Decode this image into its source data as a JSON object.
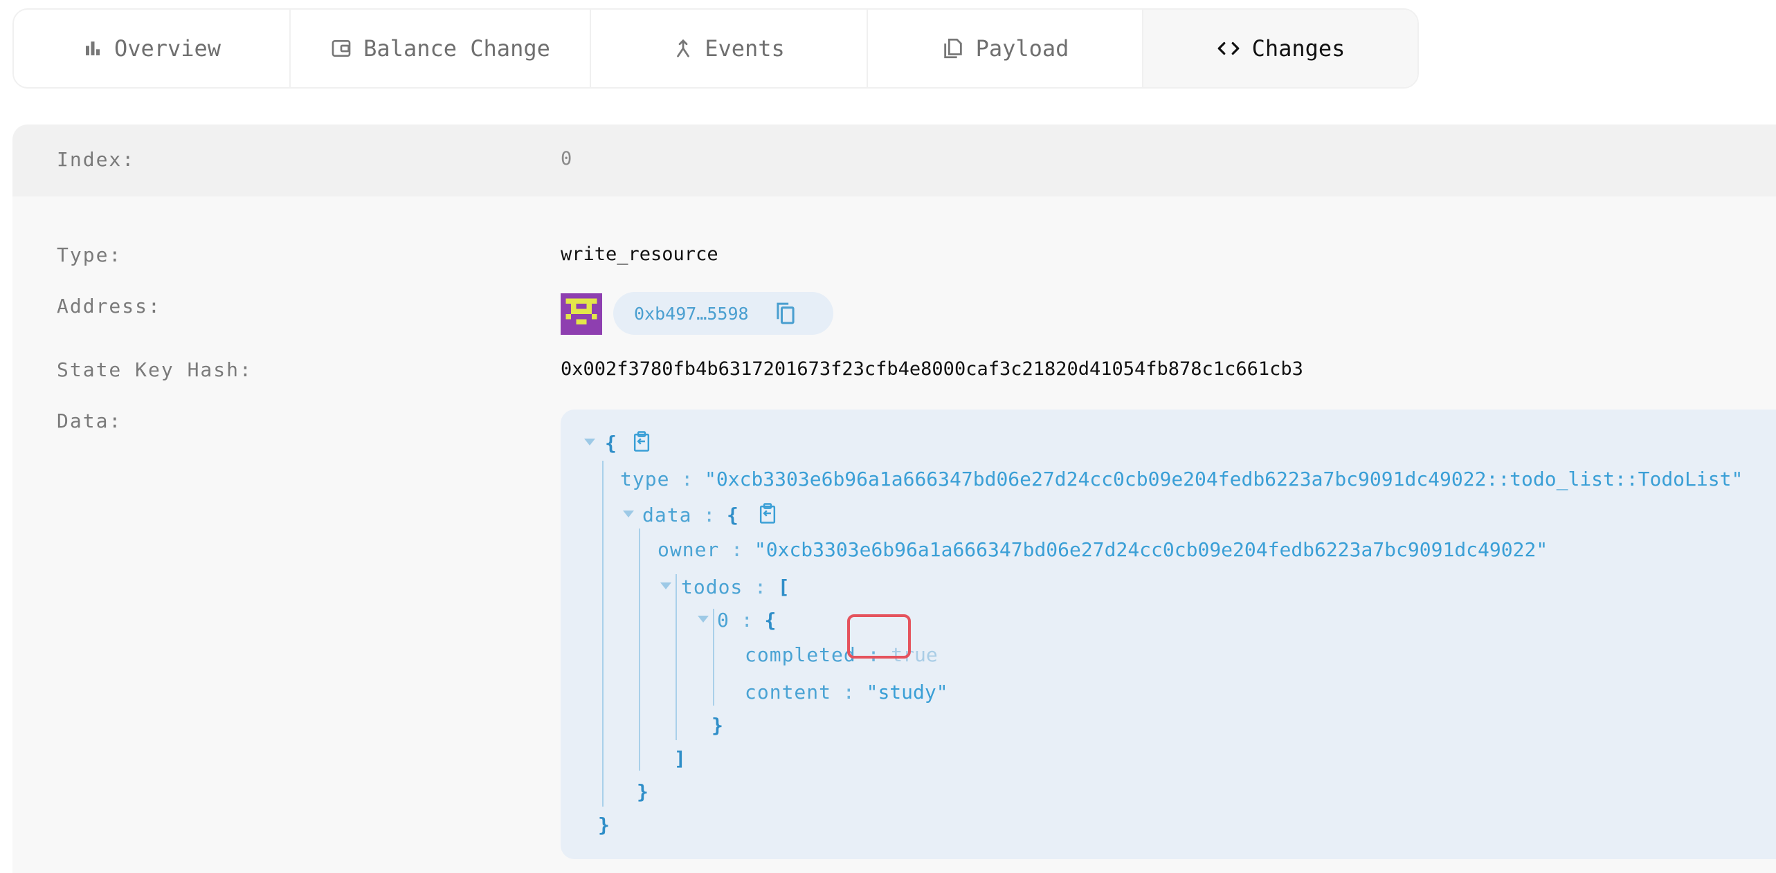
{
  "tabs": [
    {
      "label": "Overview",
      "icon": "bar-chart-icon"
    },
    {
      "label": "Balance Change",
      "icon": "wallet-icon"
    },
    {
      "label": "Events",
      "icon": "merge-icon"
    },
    {
      "label": "Payload",
      "icon": "copy-file-icon"
    },
    {
      "label": "Changes",
      "icon": "code-icon",
      "active": true
    }
  ],
  "change": {
    "index_label": "Index:",
    "index_value": "0",
    "type_label": "Type:",
    "type_value": "write_resource",
    "address_label": "Address:",
    "address_short": "0xb497…5598",
    "state_key_hash_label": "State Key Hash:",
    "state_key_hash": "0x002f3780fb4b6317201673f23cfb4e8000caf3c21820d41054fb878c1c661cb3",
    "data_label": "Data:"
  },
  "json": {
    "open_brace": "{",
    "close_brace": "}",
    "open_bracket": "[",
    "close_bracket": "]",
    "colon": ":",
    "type_key": "type",
    "type_value": "\"0xcb3303e6b96a1a666347bd06e27d24cc0cb09e204fedb6223a7bc9091dc49022::todo_list::TodoList\"",
    "data_key": "data",
    "owner_key": "owner",
    "owner_value": "\"0xcb3303e6b96a1a666347bd06e27d24cc0cb09e204fedb6223a7bc9091dc49022\"",
    "todos_key": "todos",
    "item0_key": "0",
    "completed_key": "completed",
    "completed_value": "true",
    "content_key": "content",
    "content_value": "\"study\""
  },
  "colors": {
    "accent": "#4a9fd0",
    "highlight_border": "#e5535d",
    "avatar_purple": "#8e3fb0",
    "avatar_yellow": "#e3e64a"
  }
}
